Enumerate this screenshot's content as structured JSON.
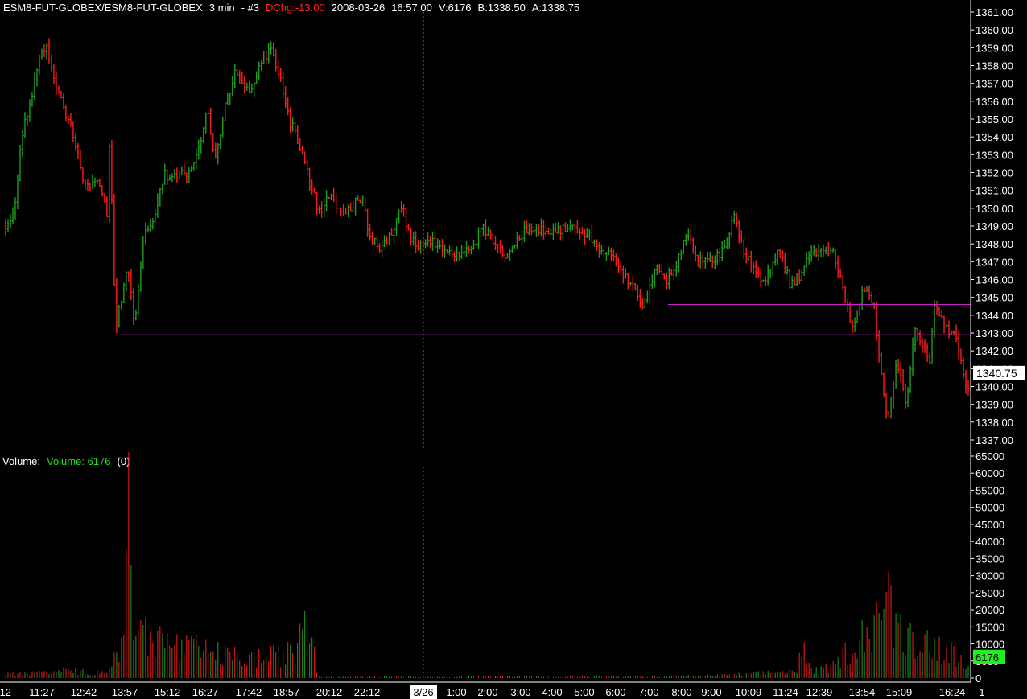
{
  "header": {
    "symbol": "ESM8-FUT-GLOBEX/ESM8-FUT-GLOBEX",
    "interval": "3 min",
    "id": "- #3",
    "dchg": "DChg:-13.00",
    "date": "2008-03-26",
    "time": "16:57:00",
    "volume": "V:6176",
    "bid": "B:1338.50",
    "ask": "A:1338.75"
  },
  "volume_header": {
    "label": "Volume:",
    "value": "Volume: 6176",
    "extra": "(0)"
  },
  "price_tag": "1340.75",
  "volume_tag": "6176",
  "colors": {
    "up": "#1e9e1e",
    "down": "#ff1a1a",
    "background": "#000000",
    "hline": "#cc22cc",
    "axis_text": "#ffffff",
    "volume_tag_bg": "#22ee22"
  },
  "chart_data": [
    {
      "type": "candlestick",
      "title": "ESM8-FUT-GLOBEX 3 min",
      "y_ticks": [
        "1361.00",
        "1360.00",
        "1359.00",
        "1358.00",
        "1357.00",
        "1356.00",
        "1355.00",
        "1354.00",
        "1353.00",
        "1352.00",
        "1351.00",
        "1350.00",
        "1349.00",
        "1348.00",
        "1347.00",
        "1346.00",
        "1345.00",
        "1344.00",
        "1343.00",
        "1342.00",
        "1341.00",
        "1340.00",
        "1339.00",
        "1338.00",
        "1337.00"
      ],
      "ylim": [
        1337,
        1361
      ],
      "last_price": 1340.75,
      "horizontal_lines": [
        1342.9,
        1344.6
      ],
      "price_path": [
        [
          0,
          1349.0
        ],
        [
          0.7,
          1349.8
        ],
        [
          1.3,
          1354.2
        ],
        [
          2.0,
          1356.1
        ],
        [
          2.6,
          1358.4
        ],
        [
          3.2,
          1359.3
        ],
        [
          4.0,
          1356.6
        ],
        [
          5.0,
          1354.9
        ],
        [
          6.2,
          1351.2
        ],
        [
          7.4,
          1351.4
        ],
        [
          8.0,
          1349.5
        ],
        [
          8.2,
          1355.6
        ],
        [
          8.4,
          1347.1
        ],
        [
          8.7,
          1343.6
        ],
        [
          9.2,
          1345.3
        ],
        [
          9.6,
          1346.6
        ],
        [
          10.1,
          1343.4
        ],
        [
          10.8,
          1348.4
        ],
        [
          11.7,
          1349.5
        ],
        [
          12.4,
          1351.9
        ],
        [
          13.2,
          1351.7
        ],
        [
          14.5,
          1352.1
        ],
        [
          15.3,
          1354.0
        ],
        [
          15.9,
          1355.6
        ],
        [
          16.4,
          1352.4
        ],
        [
          17.2,
          1355.6
        ],
        [
          18.0,
          1357.6
        ],
        [
          18.6,
          1357.0
        ],
        [
          19.1,
          1356.3
        ],
        [
          20.2,
          1358.3
        ],
        [
          20.8,
          1358.9
        ],
        [
          21.5,
          1357.5
        ],
        [
          22.0,
          1355.4
        ],
        [
          23.4,
          1352.9
        ],
        [
          23.9,
          1351.2
        ],
        [
          24.7,
          1349.6
        ],
        [
          25.2,
          1350.6
        ],
        [
          26.6,
          1349.8
        ],
        [
          28.0,
          1350.6
        ],
        [
          28.4,
          1348.6
        ],
        [
          29.3,
          1347.8
        ],
        [
          30.3,
          1348.5
        ],
        [
          31.2,
          1350.3
        ],
        [
          31.5,
          1348.8
        ],
        [
          32.1,
          1347.9
        ],
        [
          33.6,
          1348.1
        ],
        [
          35.0,
          1347.4
        ],
        [
          36.6,
          1347.8
        ],
        [
          37.4,
          1349.0
        ],
        [
          38.3,
          1348.0
        ],
        [
          39.3,
          1347.1
        ],
        [
          40.5,
          1348.6
        ],
        [
          41.5,
          1348.7
        ],
        [
          42.7,
          1348.8
        ],
        [
          44.7,
          1348.9
        ],
        [
          45.8,
          1348.5
        ],
        [
          46.4,
          1347.6
        ],
        [
          47.6,
          1347.5
        ],
        [
          48.4,
          1346.1
        ],
        [
          49.1,
          1345.8
        ],
        [
          50.0,
          1344.4
        ],
        [
          51.0,
          1346.9
        ],
        [
          51.7,
          1345.7
        ],
        [
          52.6,
          1346.6
        ],
        [
          53.3,
          1348.7
        ],
        [
          54.4,
          1347.0
        ],
        [
          55.1,
          1346.9
        ],
        [
          56.6,
          1347.8
        ],
        [
          57.1,
          1349.8
        ],
        [
          57.8,
          1347.6
        ],
        [
          58.7,
          1346.6
        ],
        [
          59.6,
          1345.8
        ],
        [
          60.6,
          1347.7
        ],
        [
          61.5,
          1345.8
        ],
        [
          62.4,
          1346.3
        ],
        [
          63.1,
          1347.5
        ],
        [
          64.1,
          1347.6
        ],
        [
          65.0,
          1347.5
        ],
        [
          66.4,
          1343.2
        ],
        [
          67.3,
          1345.7
        ],
        [
          68.1,
          1344.6
        ],
        [
          68.6,
          1340.8
        ],
        [
          69.2,
          1338.2
        ],
        [
          69.9,
          1341.6
        ],
        [
          70.6,
          1339.1
        ],
        [
          71.4,
          1343.4
        ],
        [
          72.5,
          1341.2
        ],
        [
          72.8,
          1344.7
        ],
        [
          73.6,
          1343.6
        ],
        [
          74.7,
          1342.4
        ],
        [
          75.2,
          1340.1
        ],
        [
          75.5,
          1340.0
        ]
      ],
      "x_ticks": [
        ":12",
        "11:27",
        "12:42",
        "13:57",
        "15:12",
        "16:27",
        "17:42",
        "18:57",
        "20:12",
        "22:12",
        "3/26",
        "1:00",
        "2:00",
        "3:00",
        "4:00",
        "5:00",
        "6:00",
        "7:00",
        "8:00",
        "9:00",
        "10:09",
        "11:24",
        "12:39",
        "13:54",
        "15:09",
        "16:24",
        "1"
      ]
    },
    {
      "type": "bar",
      "title": "Volume",
      "series_name": "Volume",
      "last_value": 6176,
      "y_ticks": [
        "65000",
        "60000",
        "55000",
        "50000",
        "45000",
        "40000",
        "35000",
        "30000",
        "25000",
        "20000",
        "15000",
        "10000",
        "5000",
        "0"
      ],
      "ylim": [
        0,
        65000
      ],
      "volume_path": [
        [
          0,
          1500
        ],
        [
          1,
          2000
        ],
        [
          2,
          1800
        ],
        [
          3,
          2500
        ],
        [
          4,
          3000
        ],
        [
          5,
          2500
        ],
        [
          6,
          2000
        ],
        [
          7,
          3000
        ],
        [
          7.5,
          7000
        ],
        [
          8.0,
          15000
        ],
        [
          8.3,
          30000
        ],
        [
          8.5,
          62000
        ],
        [
          8.8,
          23000
        ],
        [
          9.4,
          18000
        ],
        [
          10,
          16000
        ],
        [
          11,
          14000
        ],
        [
          12,
          12000
        ],
        [
          13,
          11000
        ],
        [
          14,
          10000
        ],
        [
          15,
          9000
        ],
        [
          16,
          8000
        ],
        [
          17,
          7500
        ],
        [
          18,
          8000
        ],
        [
          19,
          9000
        ],
        [
          20,
          10000
        ],
        [
          20.7,
          30000
        ],
        [
          21.3,
          12000
        ],
        [
          21.5,
          500
        ],
        [
          25,
          500
        ],
        [
          27.6,
          600
        ],
        [
          30,
          400
        ],
        [
          35,
          600
        ],
        [
          40,
          500
        ],
        [
          45,
          700
        ],
        [
          49,
          900
        ],
        [
          52,
          1800
        ],
        [
          54.6,
          3000
        ],
        [
          55,
          13000
        ],
        [
          55.5,
          2500
        ],
        [
          57,
          4000
        ],
        [
          60,
          22000
        ],
        [
          60.7,
          33000
        ],
        [
          61.3,
          20000
        ],
        [
          62,
          18000
        ],
        [
          63,
          15000
        ],
        [
          64,
          13000
        ],
        [
          65,
          10000
        ],
        [
          65.5,
          9000
        ],
        [
          66.4,
          7000
        ]
      ]
    }
  ]
}
